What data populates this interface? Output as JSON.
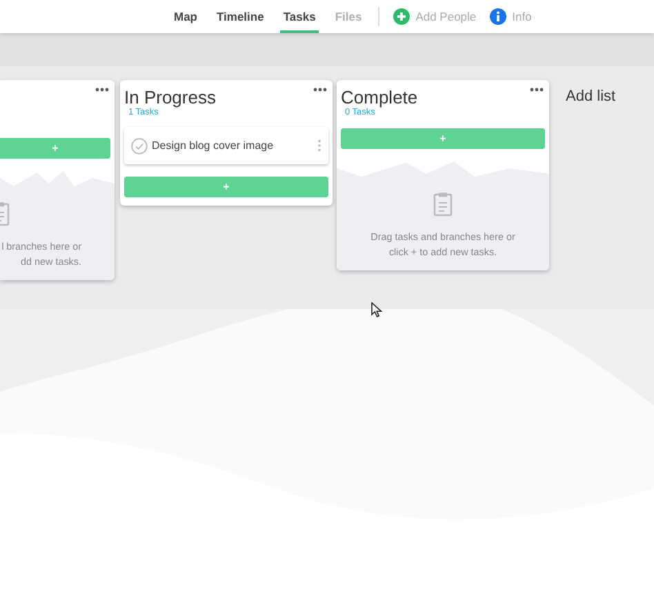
{
  "nav": {
    "tabs": [
      {
        "label": "Map",
        "selected": false,
        "disabled": false
      },
      {
        "label": "Timeline",
        "selected": false,
        "disabled": false
      },
      {
        "label": "Tasks",
        "selected": true,
        "disabled": false
      },
      {
        "label": "Files",
        "selected": false,
        "disabled": true
      }
    ],
    "actions": [
      {
        "label": "Add People",
        "kind": "add"
      },
      {
        "label": "Info",
        "kind": "info"
      }
    ]
  },
  "lists": [
    {
      "add_label": "+",
      "empty_hint": [
        "l branches here or",
        "dd new tasks."
      ]
    },
    {
      "title": "In Progress",
      "count": "1 Tasks",
      "add_label": "+",
      "tasks": [
        {
          "title": "Design blog cover image",
          "done": false
        }
      ]
    },
    {
      "title": "Complete",
      "count": "0 Tasks",
      "add_label": "+",
      "empty_hint": [
        "Drag tasks and branches here or",
        "click + to add new tasks."
      ]
    }
  ],
  "add_list": "Add list"
}
